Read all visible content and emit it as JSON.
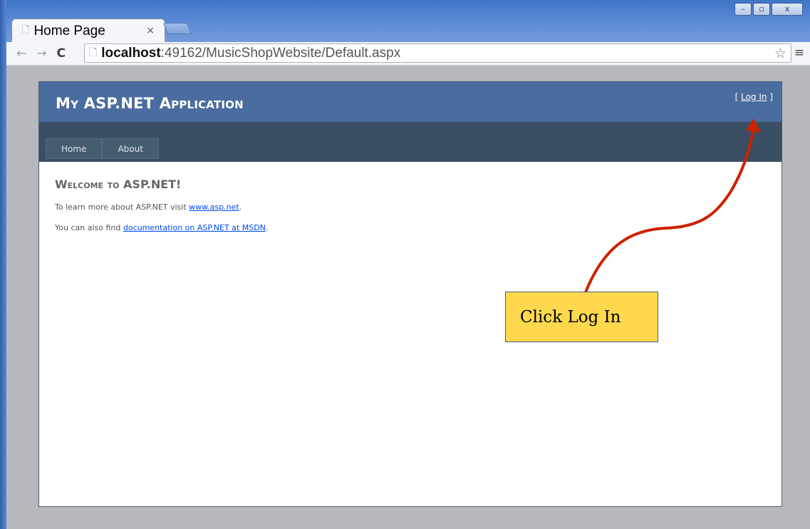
{
  "browser": {
    "tab_title": "Home Page",
    "tab_close": "×",
    "url_host": "localhost",
    "url_rest": ":49162/MusicShopWebsite/Default.aspx"
  },
  "site": {
    "title": "My ASP.NET Application",
    "login_open": "[ ",
    "login_label": "Log In",
    "login_close": " ]",
    "menu": [
      {
        "label": "Home"
      },
      {
        "label": "About"
      }
    ],
    "heading": "Welcome to ASP.NET!",
    "line1_prefix": "To learn more about ASP.NET visit ",
    "line1_link": "www.asp.net",
    "line1_suffix": ".",
    "line2_prefix": "You can also find ",
    "line2_link": "documentation on ASP.NET at MSDN",
    "line2_suffix": "."
  },
  "annotation": {
    "text": "Click Log In",
    "color": "#ffd84d",
    "arrow_color": "#cc2200"
  },
  "colors": {
    "header": "#4b6c9e",
    "nav": "#3a4f63",
    "link": "#034af3"
  }
}
